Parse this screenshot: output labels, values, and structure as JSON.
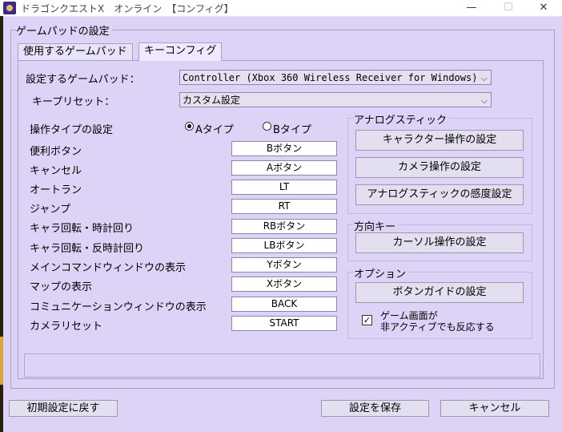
{
  "window": {
    "title": "ドラゴンクエストX　オンライン　【コンフィグ】",
    "minimize_glyph": "—",
    "maximize_glyph": "☐",
    "close_glyph": "✕"
  },
  "group_title": "ゲームパッドの設定",
  "tabs": [
    {
      "label": "使用するゲームパッド"
    },
    {
      "label": "キーコンフィグ"
    }
  ],
  "gamepad": {
    "label": "設定するゲームパッド：",
    "value": "Controller (Xbox 360 Wireless Receiver for Windows)"
  },
  "preset": {
    "label": "キープリセット：",
    "value": "カスタム設定"
  },
  "operation_type": {
    "label": "操作タイプの設定",
    "options": [
      {
        "label": "Aタイプ",
        "selected": true
      },
      {
        "label": "Bタイプ",
        "selected": false
      }
    ]
  },
  "key_bindings": [
    {
      "label": "便利ボタン",
      "value": "Bボタン"
    },
    {
      "label": "キャンセル",
      "value": "Aボタン"
    },
    {
      "label": "オートラン",
      "value": "LT"
    },
    {
      "label": "ジャンプ",
      "value": "RT"
    },
    {
      "label": "キャラ回転・時計回り",
      "value": "RBボタン"
    },
    {
      "label": "キャラ回転・反時計回り",
      "value": "LBボタン"
    },
    {
      "label": "メインコマンドウィンドウの表示",
      "value": "Yボタン"
    },
    {
      "label": "マップの表示",
      "value": "Xボタン"
    },
    {
      "label": "コミュニケーションウィンドウの表示",
      "value": "BACK"
    },
    {
      "label": "カメラリセット",
      "value": "START"
    }
  ],
  "analog_section": {
    "title": "アナログスティック",
    "buttons": [
      "キャラクター操作の設定",
      "カメラ操作の設定",
      "アナログスティックの感度設定"
    ]
  },
  "direction_section": {
    "title": "方向キー",
    "buttons": [
      "カーソル操作の設定"
    ]
  },
  "option_section": {
    "title": "オプション",
    "buttons": [
      "ボタンガイドの設定"
    ],
    "checkbox": {
      "checked": true,
      "line1": "ゲーム画面が",
      "line2": "非アクティブでも反応する"
    }
  },
  "footer": {
    "reset_label": "初期設定に戻す",
    "save_label": "設定を保存",
    "cancel_label": "キャンセル"
  }
}
